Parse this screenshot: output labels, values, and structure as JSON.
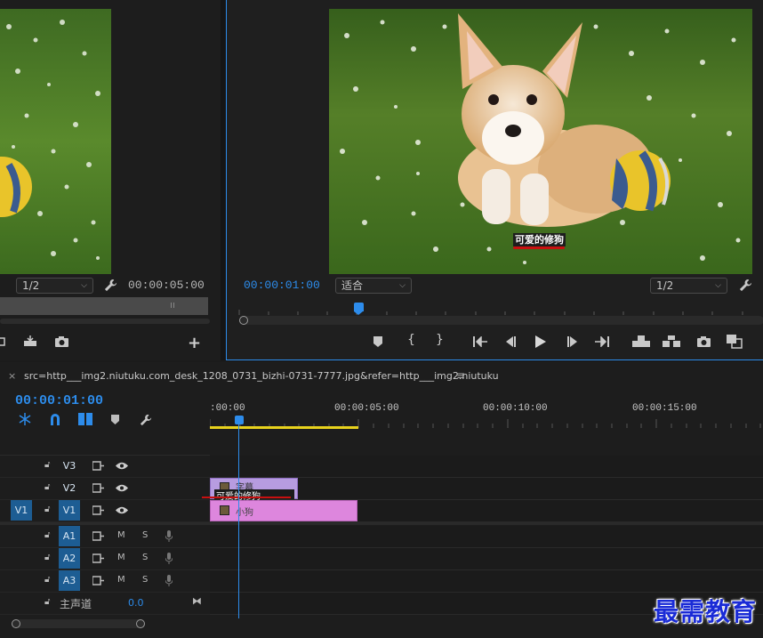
{
  "source_monitor": {
    "zoom": "1/2",
    "timecode": "00:00:05:00"
  },
  "program_monitor": {
    "timecode": "00:00:01:00",
    "fit": "适合",
    "zoom": "1/2",
    "overlay_title": "可爱的修狗"
  },
  "timeline": {
    "tab_label": "src=http___img2.niutuku.com_desk_1208_0731_bizhi-0731-7777.jpg&refer=http___img2.niutuku",
    "timecode": "00:00:01:00",
    "ruler": [
      ":00:00",
      "00:00:05:00",
      "00:00:10:00",
      "00:00:15:00"
    ],
    "tracks": {
      "v3": "V3",
      "v2": "V2",
      "v1_source": "V1",
      "v1": "V1",
      "a1": "A1",
      "a2": "A2",
      "a3": "A3",
      "mute": "M",
      "solo": "S",
      "master_label": "主声道",
      "master_value": "0.0"
    },
    "clips": {
      "v2_title": "字幕",
      "v2_text": "可爱的修狗",
      "v1_clip": "小狗"
    }
  },
  "watermark": "最需教育",
  "colors": {
    "accent": "#2d8ceb",
    "v2_clip": "#b79ce0",
    "v1_clip": "#dd86dd",
    "work_area": "#e8d21d",
    "track_active": "#1d5d93"
  }
}
